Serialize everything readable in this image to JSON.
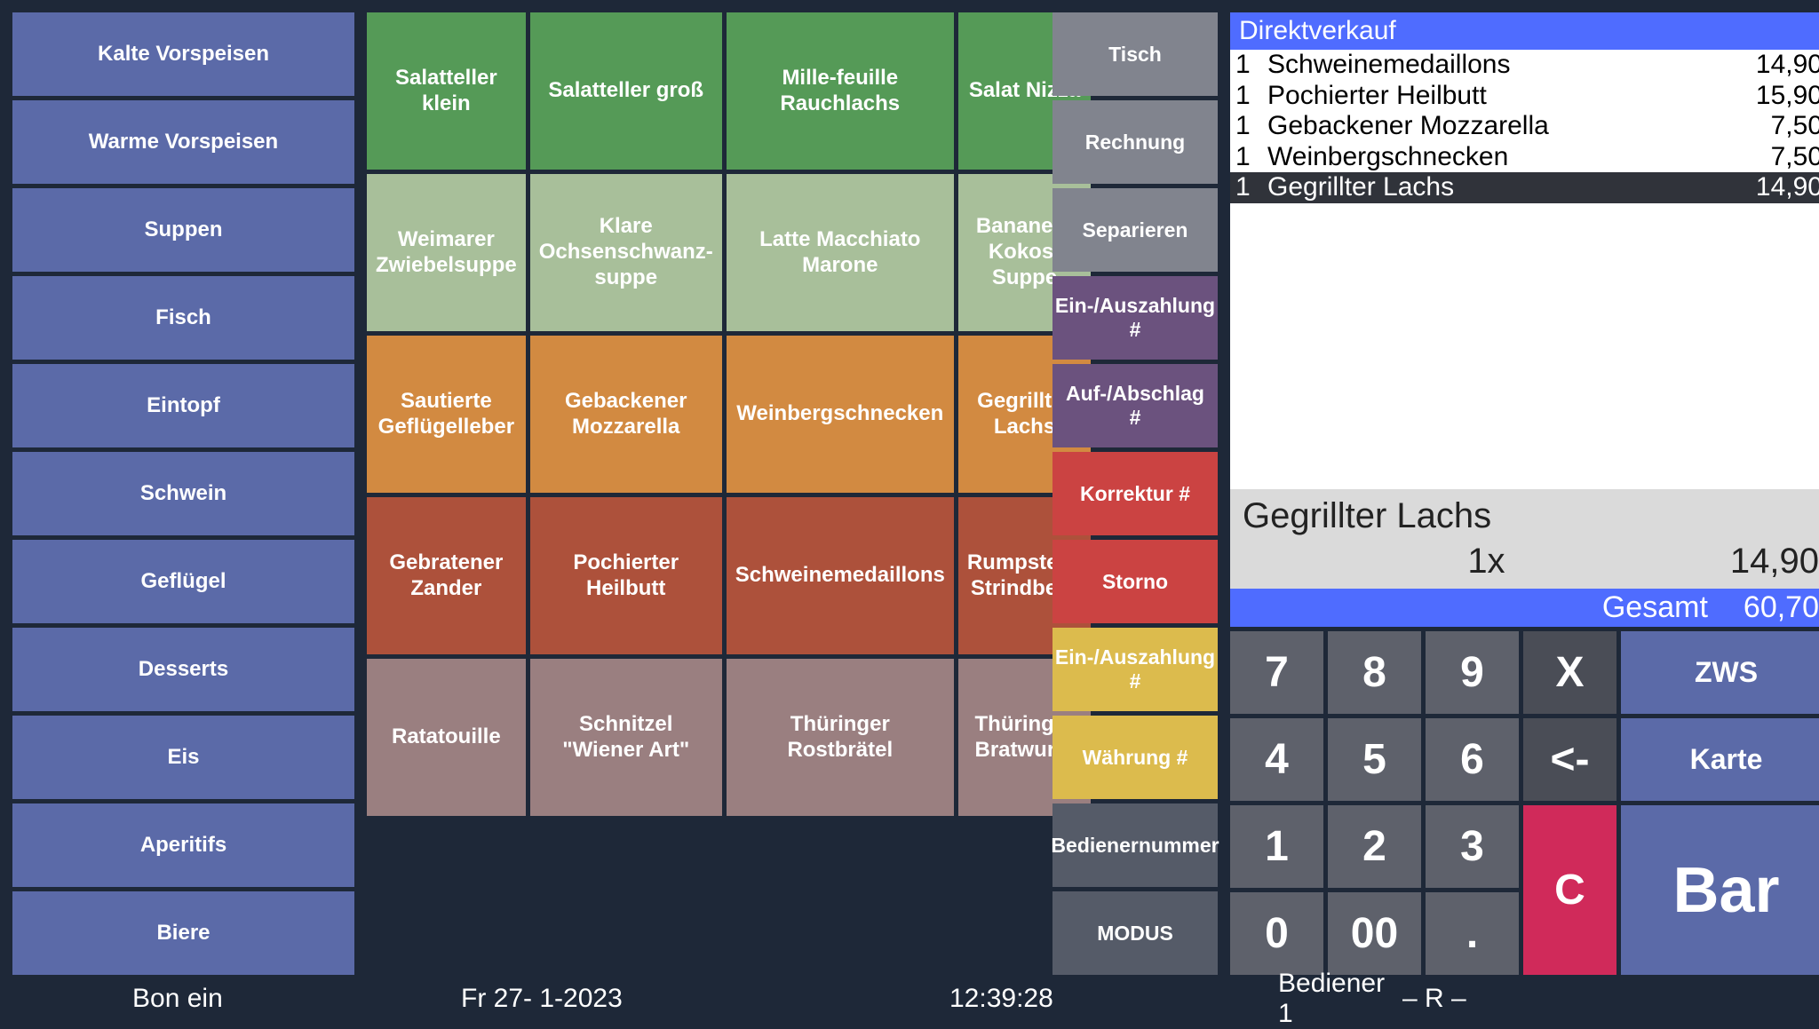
{
  "categories": [
    "Kalte Vorspeisen",
    "Warme Vorspeisen",
    "Suppen",
    "Fisch",
    "Eintopf",
    "Schwein",
    "Geflügel",
    "Desserts",
    "Eis",
    "Aperitifs",
    "Biere"
  ],
  "products": [
    {
      "label": "Salatteller klein",
      "color": "c-green"
    },
    {
      "label": "Salatteller groß",
      "color": "c-green"
    },
    {
      "label": "Mille-feuille Rauchlachs",
      "color": "c-green"
    },
    {
      "label": "Salat Nizza",
      "color": "c-green"
    },
    {
      "label": "Weimarer Zwiebelsuppe",
      "color": "c-sage"
    },
    {
      "label": "Klare Ochsenschwanz-\nsuppe",
      "color": "c-sage"
    },
    {
      "label": "Latte Macchiato Marone",
      "color": "c-sage"
    },
    {
      "label": "Bananen- Kokos-Suppe",
      "color": "c-sage"
    },
    {
      "label": "Sautierte Geflügelleber",
      "color": "c-orange"
    },
    {
      "label": "Gebackener Mozzarella",
      "color": "c-orange"
    },
    {
      "label": "Weinbergschnecken",
      "color": "c-orange"
    },
    {
      "label": "Gegrillter Lachs",
      "color": "c-orange"
    },
    {
      "label": "Gebratener Zander",
      "color": "c-rust"
    },
    {
      "label": "Pochierter Heilbutt",
      "color": "c-rust"
    },
    {
      "label": "Schweinemedaillons",
      "color": "c-rust"
    },
    {
      "label": "Rumpsteak Strindberg",
      "color": "c-rust"
    },
    {
      "label": "Ratatouille",
      "color": "c-mauve"
    },
    {
      "label": "Schnitzel \"Wiener Art\"",
      "color": "c-mauve"
    },
    {
      "label": "Thüringer Rostbrätel",
      "color": "c-mauve"
    },
    {
      "label": "Thüringer Bratwurst",
      "color": "c-mauve"
    }
  ],
  "actions": [
    {
      "label": "Tisch",
      "color": "a-grey"
    },
    {
      "label": "Rechnung",
      "color": "a-grey"
    },
    {
      "label": "Separieren",
      "color": "a-grey"
    },
    {
      "label": "Ein-/Auszahlung #",
      "color": "a-purple"
    },
    {
      "label": "Auf-/Abschlag #",
      "color": "a-purple"
    },
    {
      "label": "Korrektur #",
      "color": "a-red"
    },
    {
      "label": "Storno",
      "color": "a-red"
    },
    {
      "label": "Ein-/Auszahlung #",
      "color": "a-yellow"
    },
    {
      "label": "Währung #",
      "color": "a-yellow"
    },
    {
      "label": "Bedienernummer",
      "color": "a-slate"
    },
    {
      "label": "MODUS",
      "color": "a-slate"
    }
  ],
  "receipt": {
    "header": "Direktverkauf",
    "lines": [
      {
        "qty": "1",
        "name": "Schweinemedaillons",
        "price": "14,90",
        "selected": false
      },
      {
        "qty": "1",
        "name": "Pochierter Heilbutt",
        "price": "15,90",
        "selected": false
      },
      {
        "qty": "1",
        "name": "Gebackener Mozzarella",
        "price": "7,50",
        "selected": false
      },
      {
        "qty": "1",
        "name": "Weinbergschnecken",
        "price": "7,50",
        "selected": false
      },
      {
        "qty": "1",
        "name": "Gegrillter Lachs",
        "price": "14,90",
        "selected": true
      }
    ],
    "current": {
      "name": "Gegrillter Lachs",
      "qty": "1x",
      "price": "14,90"
    },
    "total_label": "Gesamt",
    "total_value": "60,70"
  },
  "keypad": {
    "keys_row1": [
      "7",
      "8",
      "9",
      "X"
    ],
    "keys_row2": [
      "4",
      "5",
      "6",
      "<-"
    ],
    "keys_row3": [
      "1",
      "2",
      "3"
    ],
    "keys_row4": [
      "0",
      "00",
      "."
    ],
    "clear": "C",
    "zws": "ZWS",
    "karte": "Karte",
    "bar": "Bar"
  },
  "footer": {
    "bon": "Bon ein",
    "date": "Fr  27- 1-2023",
    "time": "12:39:28",
    "user": "Bediener 1",
    "rmode": "– R –"
  }
}
